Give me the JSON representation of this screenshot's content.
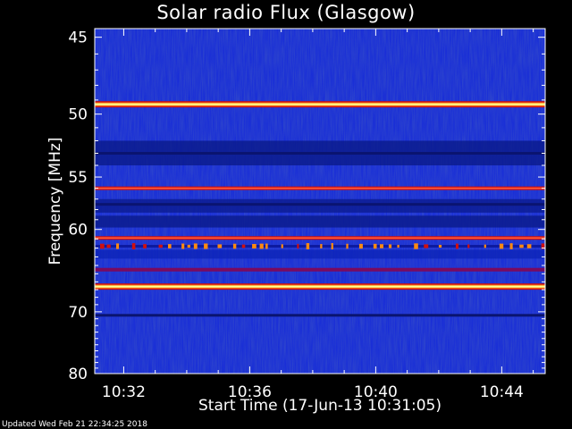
{
  "chart_data": {
    "type": "heatmap",
    "title": "Solar radio Flux (Glasgow)",
    "xlabel": "Start Time (17-Jun-13 10:31:05)",
    "ylabel": "Frequency [MHz]",
    "x_ticks": [
      "10:32",
      "10:36",
      "10:40",
      "10:44"
    ],
    "x_tick_minutes": [
      0.92,
      4.92,
      8.92,
      12.92
    ],
    "x_range_minutes": [
      0,
      14.3
    ],
    "y_ticks": [
      45,
      50,
      55,
      60,
      70,
      80
    ],
    "y_range": [
      44.5,
      80
    ],
    "y_scale": "reciprocal",
    "emission_bands": [
      {
        "freq_mhz": 49.3,
        "intensity": "very high"
      },
      {
        "freq_mhz": 53.0,
        "intensity": "low"
      },
      {
        "freq_mhz": 56.0,
        "intensity": "high"
      },
      {
        "freq_mhz": 57.5,
        "intensity": "low"
      },
      {
        "freq_mhz": 60.9,
        "intensity": "high"
      },
      {
        "freq_mhz": 61.8,
        "intensity": "bursty"
      },
      {
        "freq_mhz": 64.5,
        "intensity": "medium"
      },
      {
        "freq_mhz": 66.6,
        "intensity": "very high"
      },
      {
        "freq_mhz": 70.5,
        "intensity": "low"
      }
    ],
    "colors": {
      "background": "#000000",
      "low": "#0a1a8a",
      "mid": "#1b3cff",
      "high": "#d01010",
      "peak": "#ffff90"
    }
  },
  "footer": "Updated Wed Feb 21 22:34:25 2018"
}
